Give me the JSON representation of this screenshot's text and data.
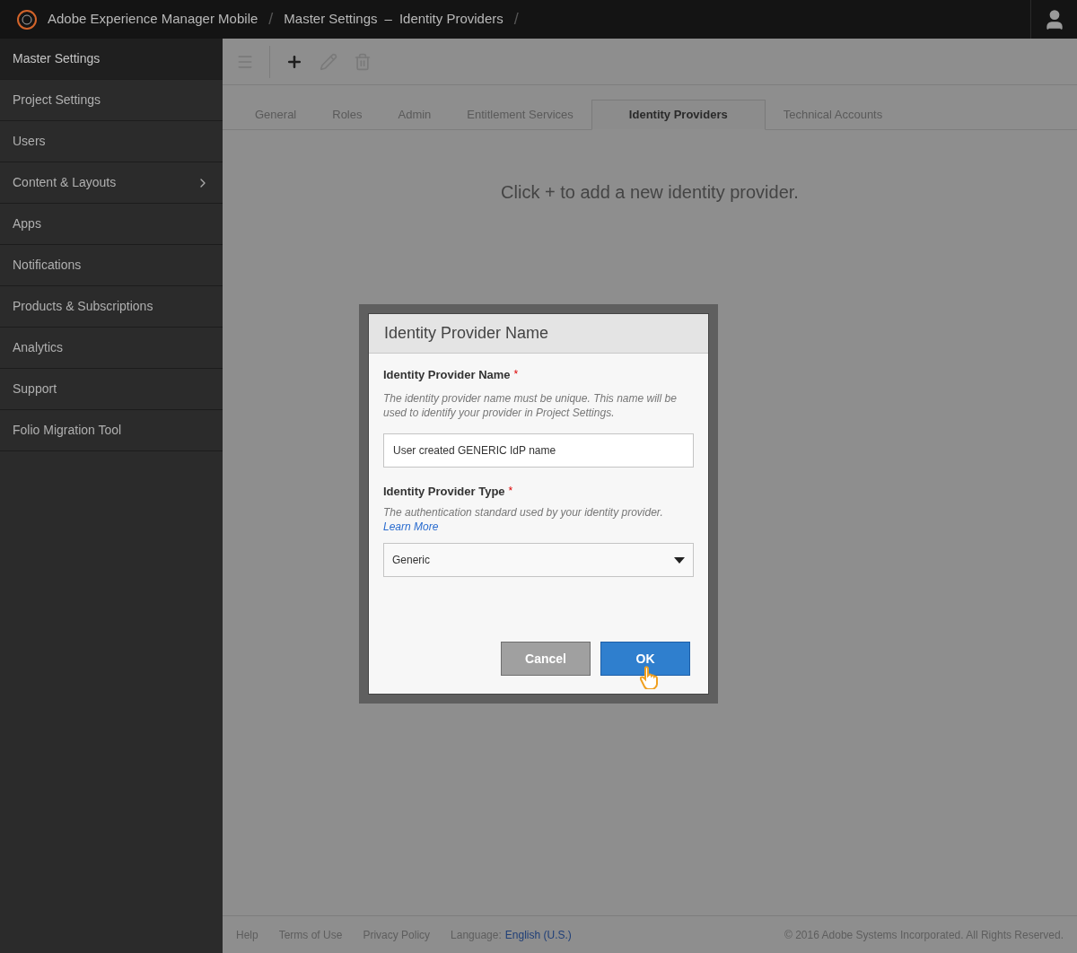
{
  "header": {
    "app_title": "Adobe Experience Manager Mobile",
    "separator": "/",
    "breadcrumb": [
      "Master Settings",
      "Identity Providers"
    ],
    "breadcrumb_dash": "–",
    "trailing_separator": "/"
  },
  "sidebar": {
    "items": [
      {
        "label": "Master Settings",
        "selected": true,
        "expandable": false
      },
      {
        "label": "Project Settings",
        "selected": false,
        "expandable": false
      },
      {
        "label": "Users",
        "selected": false,
        "expandable": false
      },
      {
        "label": "Content & Layouts",
        "selected": false,
        "expandable": true
      },
      {
        "label": "Apps",
        "selected": false,
        "expandable": false
      },
      {
        "label": "Notifications",
        "selected": false,
        "expandable": false
      },
      {
        "label": "Products & Subscriptions",
        "selected": false,
        "expandable": false
      },
      {
        "label": "Analytics",
        "selected": false,
        "expandable": false
      },
      {
        "label": "Support",
        "selected": false,
        "expandable": false
      },
      {
        "label": "Folio Migration Tool",
        "selected": false,
        "expandable": false
      }
    ]
  },
  "toolbar": [
    {
      "kind": "menu",
      "disabled": true
    },
    {
      "kind": "add",
      "disabled": false
    },
    {
      "kind": "edit",
      "disabled": true
    },
    {
      "kind": "delete",
      "disabled": true
    }
  ],
  "tabs": [
    {
      "label": "General",
      "selected": false
    },
    {
      "label": "Roles",
      "selected": false
    },
    {
      "label": "Admin",
      "selected": false
    },
    {
      "label": "Entitlement Services",
      "selected": false
    },
    {
      "label": "Identity Providers",
      "selected": true
    },
    {
      "label": "Technical Accounts",
      "selected": false
    }
  ],
  "empty_message": "Click + to add a new identity provider.",
  "dialog": {
    "title": "Identity Provider Name",
    "name_field": {
      "label": "Identity Provider Name",
      "required_mark": "*",
      "help": "The identity provider name must be unique. This name will be used to identify your provider in Project Settings.",
      "value": "User created GENERIC IdP name"
    },
    "type_field": {
      "label": "Identity Provider Type",
      "required_mark": "*",
      "help": "The authentication standard used by your identity provider.",
      "link": "Learn More",
      "value": "Generic"
    },
    "buttons": [
      {
        "label": "Cancel",
        "kind": "secondary"
      },
      {
        "label": "OK",
        "kind": "primary"
      }
    ]
  },
  "footer": {
    "links": [
      "Help",
      "Terms of Use",
      "Privacy Policy"
    ],
    "language_label": "Language:",
    "language": "English (U.S.)",
    "copyright": "© 2016 Adobe Systems Incorporated. All Rights Reserved."
  }
}
